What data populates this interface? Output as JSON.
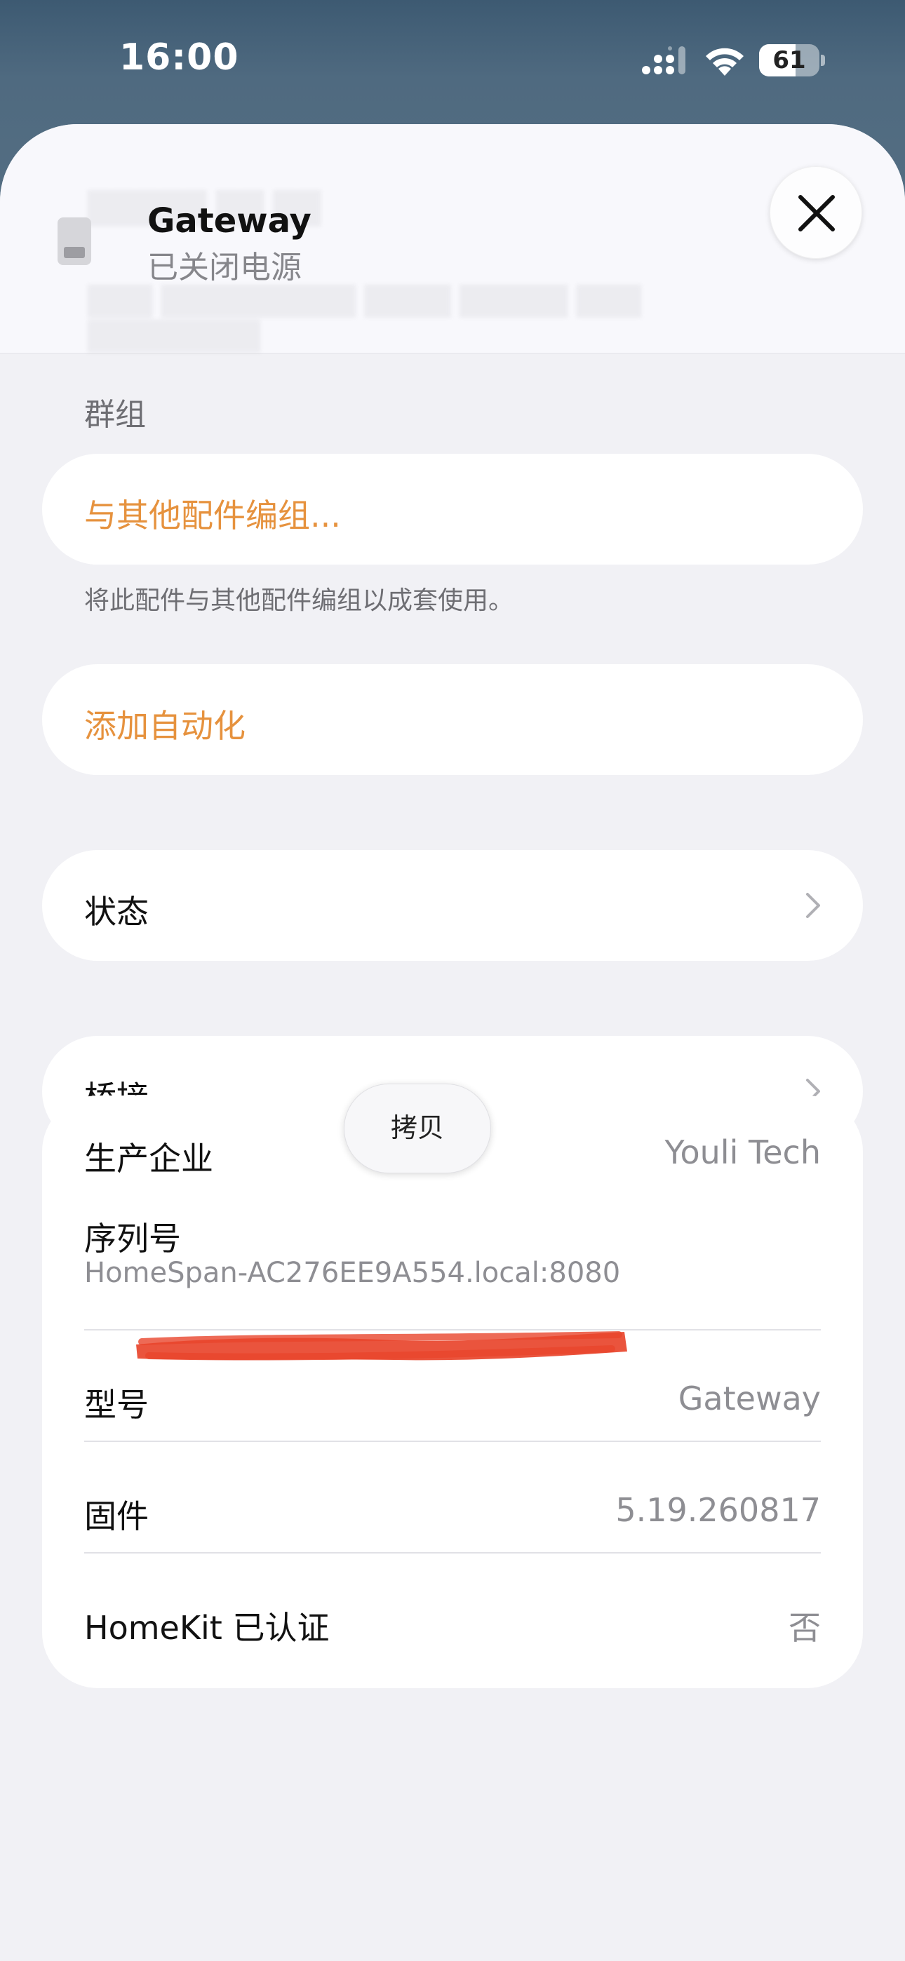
{
  "status_bar": {
    "time": "16:00",
    "battery": "61",
    "battery_level": 0.61,
    "icons": [
      "cellular-signal-icon",
      "wifi-icon",
      "battery-icon"
    ]
  },
  "header": {
    "device_name": "Gateway",
    "device_status": "已关闭电源",
    "close_icon": "close-icon",
    "device_icon": "gateway-device-icon"
  },
  "group": {
    "section_title": "群组",
    "group_action": "与其他配件编组...",
    "group_note": "将此配件与其他配件编组以成套使用。"
  },
  "automation": {
    "label": "添加自动化"
  },
  "status": {
    "label": "状态"
  },
  "bridge": {
    "label": "桥接"
  },
  "info": {
    "manufacturer_label": "生产企业",
    "manufacturer_value": "Youli Tech",
    "serial_label": "序列号",
    "serial_value": "HomeSpan-AC276EE9A554.local:8080",
    "model_label": "型号",
    "model_value": "Gateway",
    "firmware_label": "固件",
    "firmware_value": "5.19.260817",
    "homekit_label": "HomeKit 已认证",
    "homekit_value": "否"
  },
  "copy_popup": {
    "label": "拷贝"
  },
  "colors": {
    "accent": "#e6923e",
    "background": "#f1f1f5",
    "redaction": "#e8452c"
  }
}
